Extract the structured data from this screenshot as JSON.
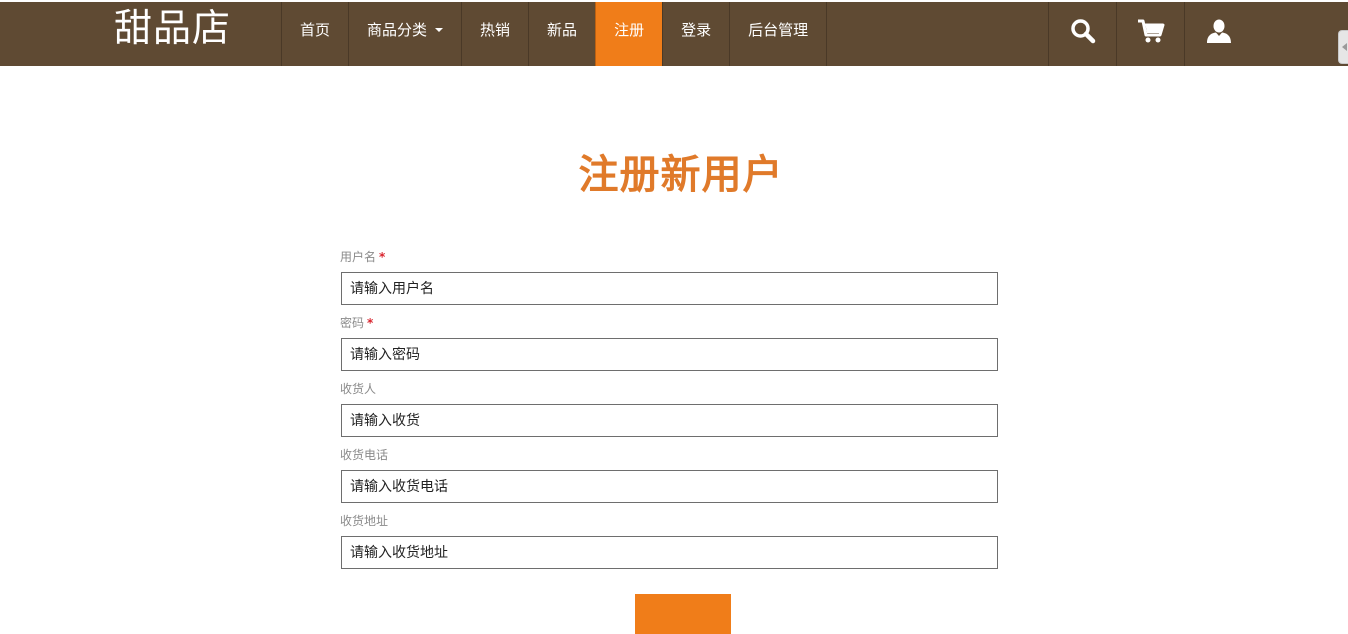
{
  "brand": "甜品店",
  "nav": [
    {
      "label": "首页"
    },
    {
      "label": "商品分类"
    },
    {
      "label": "热销"
    },
    {
      "label": "新品"
    },
    {
      "label": "注册",
      "active": true
    },
    {
      "label": "登录"
    },
    {
      "label": "后台管理"
    }
  ],
  "icons": [
    "search-icon",
    "cart-icon",
    "user-icon"
  ],
  "colors": {
    "navbar": "#5f4a33",
    "accent": "#f07d19",
    "title": "#e07a2a",
    "required": "#d9252f"
  },
  "page": {
    "title": "注册新用户"
  },
  "form": {
    "fields": [
      {
        "label": "用户名",
        "required_mark": "*",
        "placeholder": "请输入用户名"
      },
      {
        "label": "密码",
        "required_mark": "*",
        "placeholder": "请输入密码"
      },
      {
        "label": "收货人",
        "required_mark": "",
        "placeholder": "请输入收货"
      },
      {
        "label": "收货电话",
        "required_mark": "",
        "placeholder": "请输入收货电话"
      },
      {
        "label": "收货地址",
        "required_mark": "",
        "placeholder": "请输入收货地址"
      }
    ]
  }
}
